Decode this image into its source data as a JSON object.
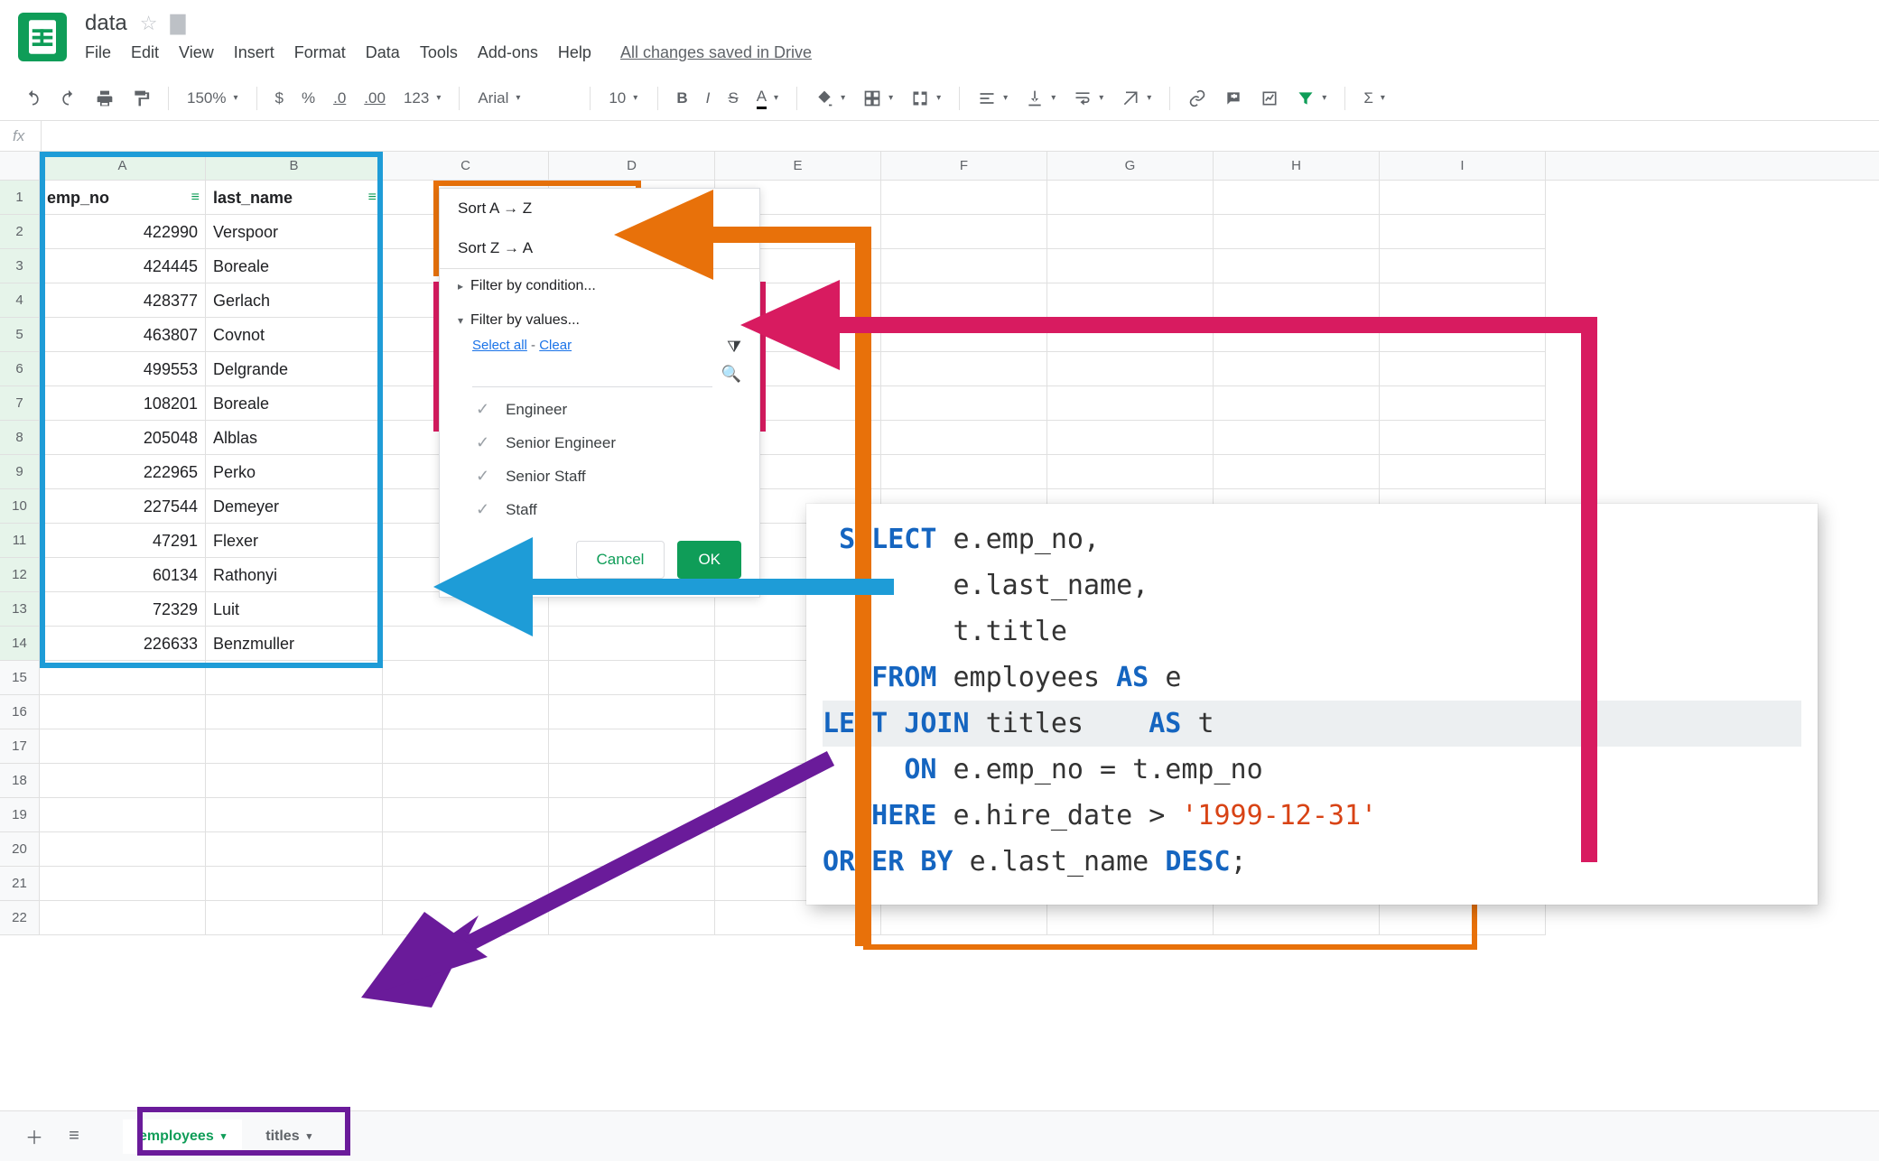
{
  "doc": {
    "title": "data",
    "saved_text": "All changes saved in Drive"
  },
  "menus": [
    "File",
    "Edit",
    "View",
    "Insert",
    "Format",
    "Data",
    "Tools",
    "Add-ons",
    "Help"
  ],
  "toolbar": {
    "zoom": "150%",
    "font": "Arial",
    "size": "10",
    "currency": "$",
    "percent": "%",
    "dec_dec": ".0",
    "inc_dec": ".00",
    "numfmt": "123",
    "bold": "B",
    "italic": "I",
    "strike": "S",
    "underlineA": "A"
  },
  "fx_label": "fx",
  "columns": [
    "A",
    "B",
    "C",
    "D",
    "E",
    "F",
    "G",
    "H",
    "I"
  ],
  "row_count": 22,
  "table": {
    "headers": {
      "A": "emp_no",
      "B": "last_name"
    },
    "rows": [
      {
        "A": "422990",
        "B": "Verspoor"
      },
      {
        "A": "424445",
        "B": "Boreale"
      },
      {
        "A": "428377",
        "B": "Gerlach"
      },
      {
        "A": "463807",
        "B": "Covnot"
      },
      {
        "A": "499553",
        "B": "Delgrande"
      },
      {
        "A": "108201",
        "B": "Boreale"
      },
      {
        "A": "205048",
        "B": "Alblas"
      },
      {
        "A": "222965",
        "B": "Perko"
      },
      {
        "A": "227544",
        "B": "Demeyer"
      },
      {
        "A": "47291",
        "B": "Flexer"
      },
      {
        "A": "60134",
        "B": "Rathonyi"
      },
      {
        "A": "72329",
        "B": "Luit"
      },
      {
        "A": "226633",
        "B": "Benzmuller"
      }
    ]
  },
  "filter": {
    "sort_az": "Sort A → Z",
    "sort_za": "Sort Z → A",
    "by_condition": "Filter by condition...",
    "by_values": "Filter by values...",
    "select_all": "Select all",
    "clear": "Clear",
    "values": [
      "Engineer",
      "Senior Engineer",
      "Senior Staff",
      "Staff"
    ],
    "cancel": "Cancel",
    "ok": "OK"
  },
  "tabs": {
    "active": "employees",
    "other": "titles"
  },
  "sql": {
    "select_kw": "SELECT",
    "sel1": "e.emp_no,",
    "sel2": "e.last_name,",
    "sel3": "t.title",
    "from_kw": "FROM",
    "from_tbl": "employees",
    "as_kw": "AS",
    "from_alias": "e",
    "join_kw": "LEFT JOIN",
    "join_tbl": "titles",
    "join_alias": "t",
    "on_kw": "ON",
    "on_expr": "e.emp_no = t.emp_no",
    "where_kw": "WHERE",
    "where_expr": "e.hire_date >",
    "where_lit": "'1999-12-31'",
    "order_kw": "ORDER BY",
    "order_expr": "e.last_name",
    "desc_kw": "DESC",
    "semicolon": ";"
  }
}
